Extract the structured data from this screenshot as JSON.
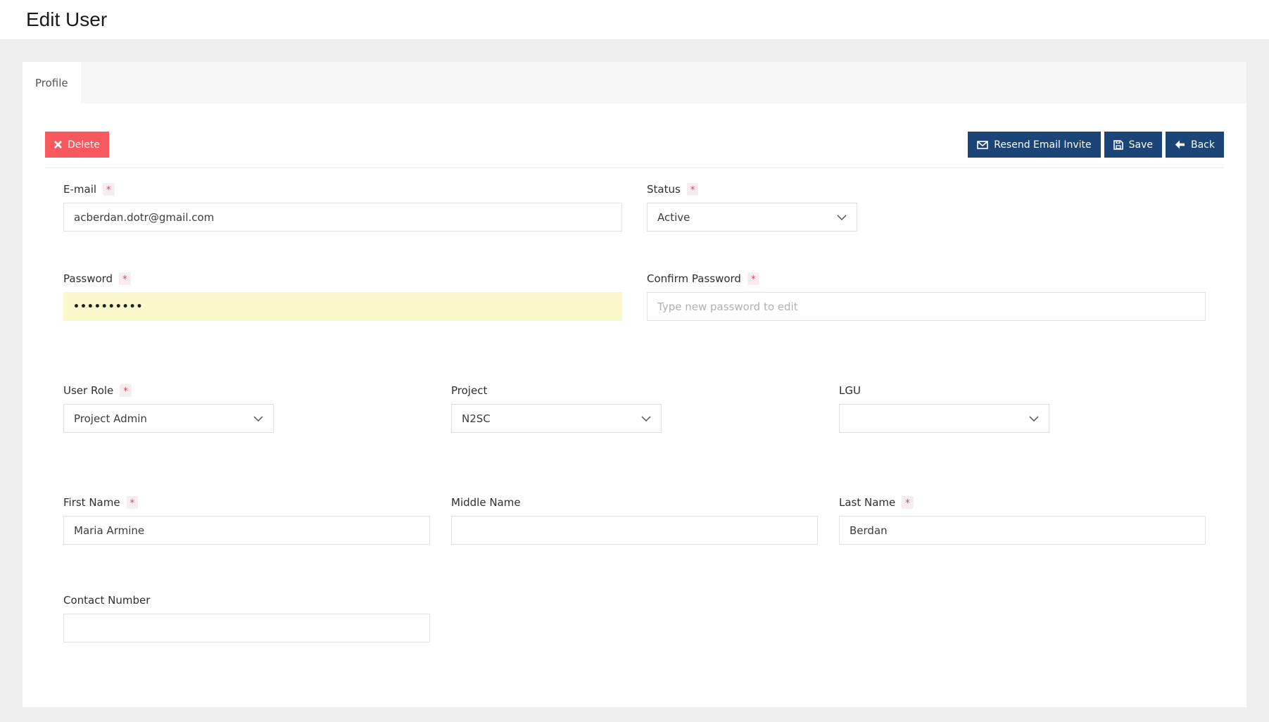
{
  "page": {
    "title": "Edit User"
  },
  "tabs": [
    {
      "label": "Profile",
      "active": true
    }
  ],
  "toolbar": {
    "delete_label": "Delete",
    "resend_label": "Resend Email Invite",
    "save_label": "Save",
    "back_label": "Back"
  },
  "form": {
    "required_marker": "*",
    "email": {
      "label": "E-mail",
      "required": true,
      "value": "acberdan.dotr@gmail.com"
    },
    "status": {
      "label": "Status",
      "required": true,
      "value": "Active"
    },
    "password": {
      "label": "Password",
      "required": true,
      "value": "••••••••••"
    },
    "confirm_password": {
      "label": "Confirm Password",
      "required": true,
      "value": "",
      "placeholder": "Type new password to edit"
    },
    "user_role": {
      "label": "User Role",
      "required": true,
      "value": "Project Admin"
    },
    "project": {
      "label": "Project",
      "required": false,
      "value": "N2SC"
    },
    "lgu": {
      "label": "LGU",
      "required": false,
      "value": ""
    },
    "first_name": {
      "label": "First Name",
      "required": true,
      "value": "Maria Armine"
    },
    "middle_name": {
      "label": "Middle Name",
      "required": false,
      "value": ""
    },
    "last_name": {
      "label": "Last Name",
      "required": true,
      "value": "Berdan"
    },
    "contact_number": {
      "label": "Contact Number",
      "required": false,
      "value": ""
    }
  },
  "colors": {
    "danger": "#f8595e",
    "primary": "#1b4576",
    "password_bg": "#fbf8cb",
    "required_color": "#d6455f",
    "required_bg": "#f7edf0"
  }
}
